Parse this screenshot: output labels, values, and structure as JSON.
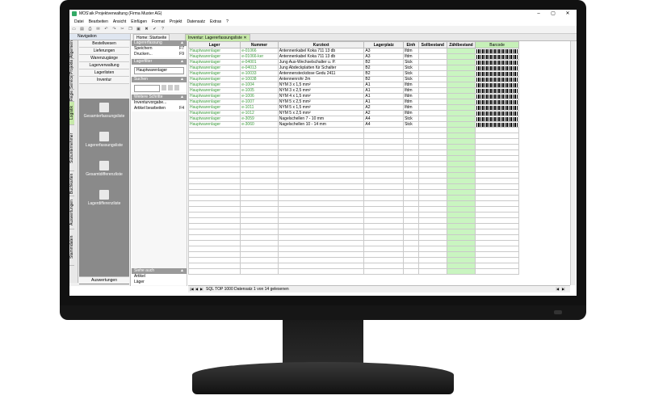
{
  "window": {
    "title": "MOS'aik Projektverwaltung (Firma Muster AG)",
    "min": "–",
    "max": "▢",
    "close": "✕"
  },
  "menu": [
    "Datei",
    "Bearbeiten",
    "Ansicht",
    "Einfügen",
    "Format",
    "Projekt",
    "Datensatz",
    "Extras",
    "?"
  ],
  "toolbar_icons": [
    "folder-icon",
    "save-icon",
    "print-icon",
    "mail-icon",
    "undo-icon",
    "redo-icon",
    "cut-icon",
    "copy-icon",
    "paste-icon",
    "delete-icon",
    "check-icon",
    "help-icon"
  ],
  "toolbar_glyphs": [
    "▭",
    "▤",
    "⎙",
    "✉",
    "↶",
    "↷",
    "✂",
    "❐",
    "▣",
    "✖",
    "✔",
    "?"
  ],
  "navigation": {
    "title": "Navigation",
    "vertical_tabs": [
      "Allgemein",
      "Projekte",
      "Service",
      "Regie",
      "Logistik",
      "Subunternehmer",
      "Buchkarten",
      "Auswertungen",
      "Stammdaten"
    ],
    "items": [
      "Bestellwesen",
      "Lieferungen",
      "Warenzugänge",
      "Lagerverwaltung",
      "Lagerlisten",
      "Inventur"
    ],
    "buttons": [
      "Gesamterfassungsliste",
      "Lagererfassungsliste",
      "Gesamtdifferenzliste",
      "Lagerdifferenzliste"
    ],
    "bottom": "Auswertungen"
  },
  "tabs": [
    {
      "label": "Home: Startseite"
    },
    {
      "label": "Inventur: Lagererfassungsliste ✕"
    }
  ],
  "side_panel": {
    "lagererfassung": {
      "title": "Lagererfassung",
      "rows": [
        {
          "label": "Speichern",
          "key": "F7"
        },
        {
          "label": "Drucken...",
          "key": "F9"
        }
      ]
    },
    "lagerfilter": {
      "title": "Lagerfilter",
      "value": "Hauptwarenlager"
    },
    "suchen": {
      "title": "Suchen"
    },
    "weitere": {
      "title": "Weitere Schritte",
      "rows": [
        {
          "label": "Inventurvorgabe...",
          "key": ""
        },
        {
          "label": "Artikel bearbeiten",
          "key": "F4"
        }
      ]
    },
    "siehe": {
      "title": "Siehe auch",
      "rows": [
        {
          "label": "Artikel",
          "key": ""
        },
        {
          "label": "Läger",
          "key": ""
        }
      ]
    }
  },
  "table": {
    "headers": [
      "Lager",
      "Nummer",
      "Kurztext",
      "Lagerplatz",
      "Einh",
      "Sollbestand",
      "Zählbestand",
      "Barcode"
    ],
    "rows": [
      [
        "Hauptwarenlager",
        "e-01066",
        "Antennenkabel Koka 711 13 db",
        "A3",
        "lfdm"
      ],
      [
        "Hauptwarenlager",
        "e-01066-ker",
        "Antennenkabel Koka 711 13 db",
        "A3",
        "lfdm"
      ],
      [
        "Hauptwarenlager",
        "e-04001",
        "Jung Aus-Wechselschalter u. P.",
        "B2",
        "Stck"
      ],
      [
        "Hauptwarenlager",
        "e-04013",
        "Jung Abdeckplatten für Schalter",
        "B2",
        "Stck"
      ],
      [
        "Hauptwarenlager",
        "e-10033",
        "Antennensteckdose Gedu 2411",
        "B2",
        "Stck"
      ],
      [
        "Hauptwarenlager",
        "e-10038",
        "Antennenrohr 2m",
        "B2",
        "Stck"
      ],
      [
        "Hauptwarenlager",
        "e-1004",
        "NYM 3 x 1,5 mm²",
        "A1",
        "lfdm"
      ],
      [
        "Hauptwarenlager",
        "e-1005",
        "NYM 3 x 2,5 mm²",
        "A1",
        "lfdm"
      ],
      [
        "Hauptwarenlager",
        "e-1006",
        "NYM 4 x 1,5 mm²",
        "A1",
        "lfdm"
      ],
      [
        "Hauptwarenlager",
        "e-1007",
        "NYM 5 x 2,5 mm²",
        "A1",
        "lfdm"
      ],
      [
        "Hauptwarenlager",
        "e-1011",
        "NYM 5 x 1,5 mm²",
        "A2",
        "lfdm"
      ],
      [
        "Hauptwarenlager",
        "e-1012",
        "NYM 5 x 2,5 mm²",
        "A2",
        "lfdm"
      ],
      [
        "Hauptwarenlager",
        "e-3059",
        "Nagelschellen 7 - 10 mm",
        "A4",
        "Stck"
      ],
      [
        "Hauptwarenlager",
        "e-3060",
        "Nagelschellen 10 - 14 mm",
        "A4",
        "Stck"
      ]
    ],
    "empty_rows": 26
  },
  "status": {
    "text": "SQL TOP 1000 Datensatz 1 von 14 gelesenen"
  },
  "colors": {
    "green_text": "#3a9a3a",
    "zaehl_bg": "#c9f5c0",
    "logistik_tab": "#c6e8a9"
  }
}
